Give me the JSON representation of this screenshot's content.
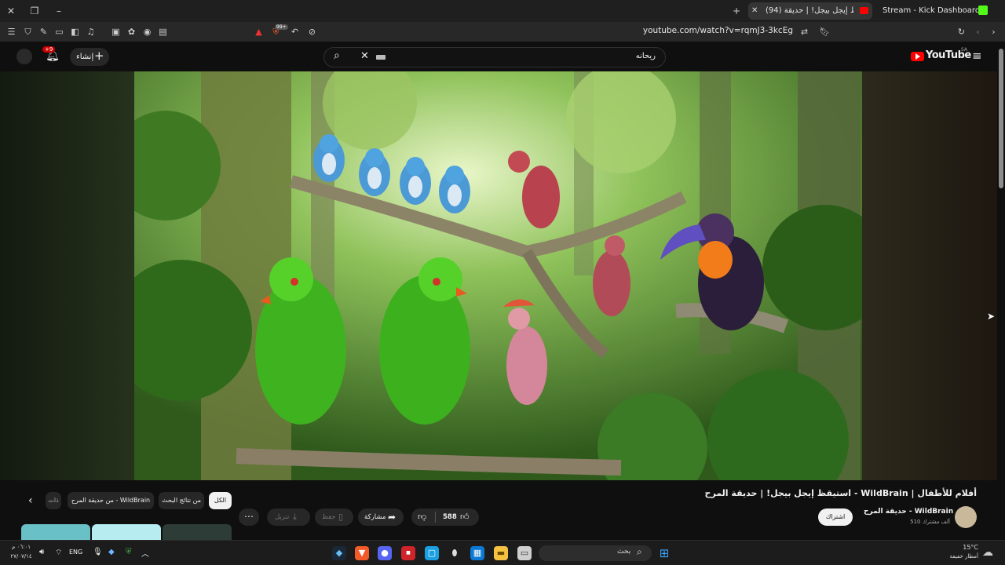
{
  "browser": {
    "tabs": [
      {
        "label": "(94) استيقظ إيجل بيجل! | حديقة",
        "active": true
      },
      {
        "label": "Stream - Kick Dashboard",
        "active": false
      }
    ],
    "url": "youtube.com/watch?v=rqmJ3-3kcEg",
    "extension_badge": "99+"
  },
  "youtube": {
    "logo": "YouTube",
    "logo_region": "SA",
    "search_value": "ريحانه",
    "create_label": "إنشاء",
    "notifications_badge": "+9",
    "video_title": "استيقظ إيجل بيجل! | حديقة المرح - WildBrain | أفلام للأطفال",
    "channel_name": "حديقة المرح - WildBrain",
    "subscribers": "510 ألف مشترك",
    "subscribe_label": "اشتراك",
    "likes": "588",
    "share_label": "مشاركة",
    "save_label": "حفظ",
    "download_label": "تنزيل",
    "chips": [
      {
        "label": "الكل",
        "selected": true
      },
      {
        "label": "من نتائج البحث",
        "selected": false
      },
      {
        "label": "من حديقة المرح - WildBrain",
        "selected": false
      },
      {
        "label": "ذات",
        "selected": false
      }
    ]
  },
  "taskbar": {
    "search_placeholder": "بحث",
    "language": "ENG",
    "time": "٠٦:٠١ م",
    "date": "٢٧/٠٧/١٤",
    "temperature": "15°C",
    "weather": "أمطار خفيفة"
  },
  "colors": {
    "yt_red": "#ff0000",
    "bg": "#0f0f0f",
    "chip": "#272727"
  }
}
